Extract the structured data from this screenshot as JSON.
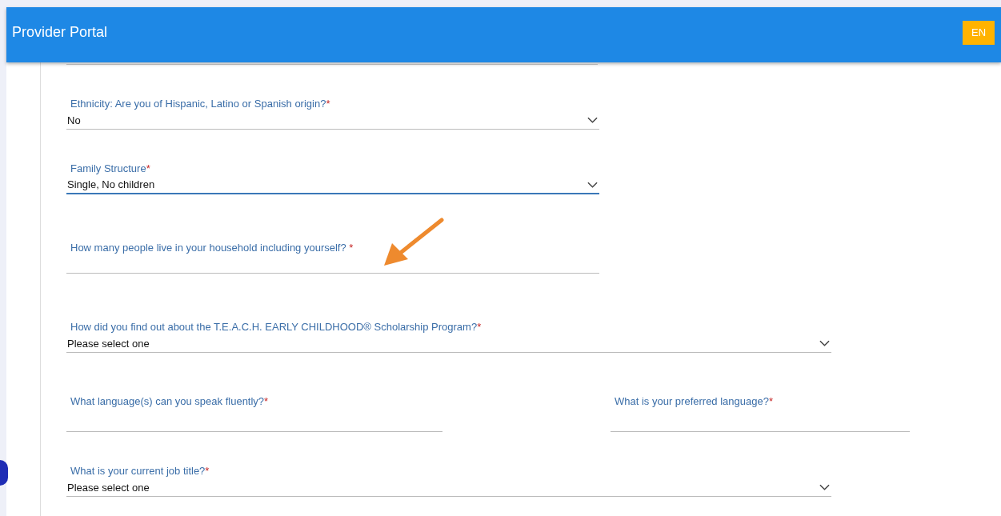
{
  "header": {
    "title": "Provider Portal",
    "language_button": "EN"
  },
  "fields": [
    {
      "kind": "select",
      "label": "Ethnicity: Are you of Hispanic, Latino or Spanish origin?",
      "mark": "*",
      "value": "No",
      "focused": false
    },
    {
      "kind": "select",
      "label": "Family Structure",
      "mark": "*",
      "value": "Single, No children",
      "focused": true
    },
    {
      "kind": "text",
      "label": "How many people live in your household including yourself?",
      "mark": " *",
      "focused": false
    },
    {
      "kind": "select",
      "label": "How did you find out about the T.E.A.C.H. EARLY CHILDHOOD® Scholarship Program?",
      "mark": "*",
      "value": "Please select one",
      "focused": false
    }
  ],
  "pair": [
    {
      "kind": "text",
      "label": "What language(s) can you speak fluently?",
      "mark": "*",
      "focused": false
    },
    {
      "kind": "text",
      "label": "What is your preferred language?",
      "mark": "*",
      "focused": false
    }
  ],
  "last": {
    "kind": "select",
    "label": "What is your current job title?",
    "mark": "*",
    "value": "Please select one",
    "focused": false
  }
}
